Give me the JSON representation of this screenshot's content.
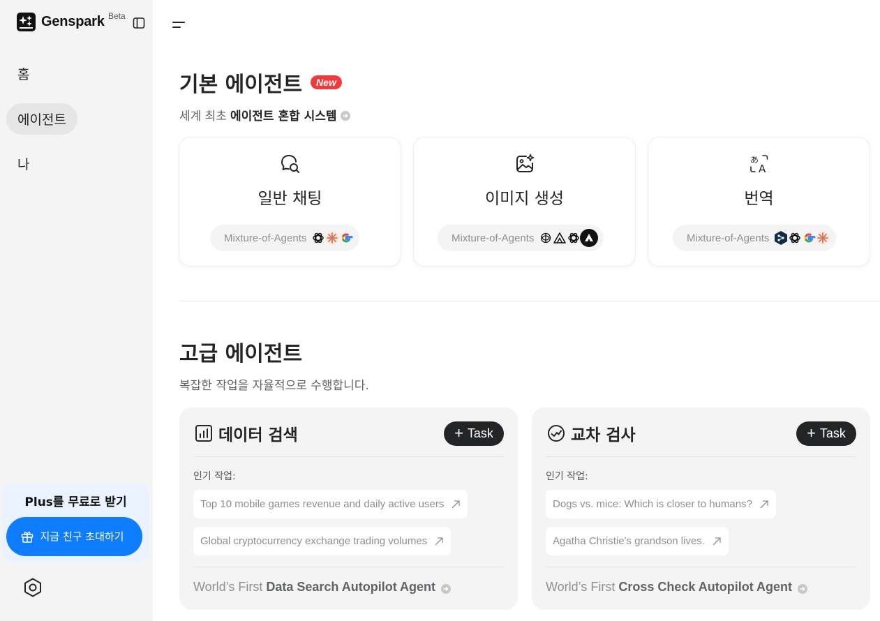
{
  "brand": {
    "name": "Genspark",
    "badge": "Beta"
  },
  "sidebar": {
    "items": [
      {
        "label": "홈",
        "active": false
      },
      {
        "label": "에이전트",
        "active": true
      },
      {
        "label": "나",
        "active": false
      }
    ],
    "promo": {
      "title": "Plus를 무료로 받기",
      "button": "지금 친구 초대하기"
    }
  },
  "basic": {
    "title": "기본 에이전트",
    "badge": "New",
    "subtitle_prefix": "세계 최초",
    "subtitle_bold": "에이전트 혼합 시스템",
    "cards": [
      {
        "title": "일반 채팅",
        "pill": "Mixture-of-Agents",
        "icon": "chat-search-icon",
        "models": [
          "openai-icon",
          "claude-icon",
          "google-icon"
        ]
      },
      {
        "title": "이미지 생성",
        "pill": "Mixture-of-Agents",
        "icon": "image-sparkle-icon",
        "models": [
          "flux-icon",
          "ideogram-icon",
          "openai-icon",
          "recraft-icon"
        ]
      },
      {
        "title": "번역",
        "pill": "Mixture-of-Agents",
        "icon": "translate-icon",
        "models": [
          "deepl-icon",
          "openai-icon",
          "google-icon",
          "claude-icon"
        ]
      }
    ]
  },
  "advanced": {
    "title": "고급 에이전트",
    "subtitle": "복잡한 작업을 자율적으로 수행합니다.",
    "cards": [
      {
        "title": "데이터 검색",
        "icon": "bar-chart-icon",
        "task_label": "Task",
        "popular_label": "인기 작업:",
        "chips": [
          "Top 10 mobile games revenue and daily active users",
          "Global cryptocurrency exchange trading volumes"
        ],
        "footer_prefix": "World’s First",
        "footer_bold": "Data Search Autopilot Agent"
      },
      {
        "title": "교차 검사",
        "icon": "check-trend-icon",
        "task_label": "Task",
        "popular_label": "인기 작업:",
        "chips": [
          "Dogs vs. mice: Which is closer to humans?",
          "Agatha Christie's grandson lives."
        ],
        "footer_prefix": "World’s First",
        "footer_bold": "Cross Check Autopilot Agent"
      }
    ]
  },
  "colors": {
    "accent": "#0f7dff",
    "new_badge": "#f13a3a",
    "dark_button": "#232425",
    "sidebar_bg": "#f4f4f4"
  }
}
